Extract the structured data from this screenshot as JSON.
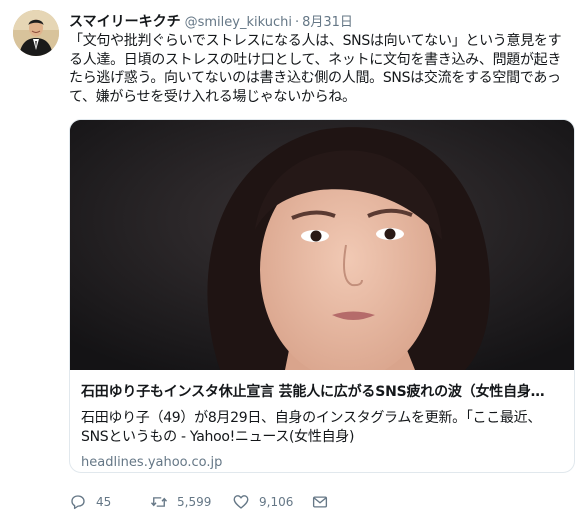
{
  "tweet": {
    "display_name": "スマイリーキクチ",
    "handle": "@smiley_kikuchi",
    "separator": "·",
    "date": "8月31日",
    "text_lines": [
      "「文句や批判ぐらいでストレスになる人は、SNSは向いてない」という意見をす",
      "る人達。日頃のストレスの吐け口として、ネットに文句を書き込み、問題が起き",
      "たら逃げ惑う。向いてないのは書き込む側の人間。SNSは交流をする空間であっ",
      "て、嫌がらせを受け入れる場じゃないからね。"
    ]
  },
  "card": {
    "title": "石田ゆり子もインスタ休止宣言 芸能人に広がるSNS疲れの波（女性自身…",
    "description_lines": [
      "石田ゆり子（49）が8月29日、自身のインスタグラムを更新。「ここ最近、",
      "SNSというもの - Yahoo!ニュース(女性自身)"
    ],
    "domain": "headlines.yahoo.co.jp"
  },
  "actions": {
    "reply_count": "45",
    "retweet_count": "5,599",
    "like_count": "9,106"
  },
  "icons": [
    "reply-icon",
    "retweet-icon",
    "like-icon",
    "message-icon"
  ],
  "colors": {
    "secondary_text": "#657786",
    "border": "#e1e8ed",
    "primary_text": "#14171a"
  }
}
